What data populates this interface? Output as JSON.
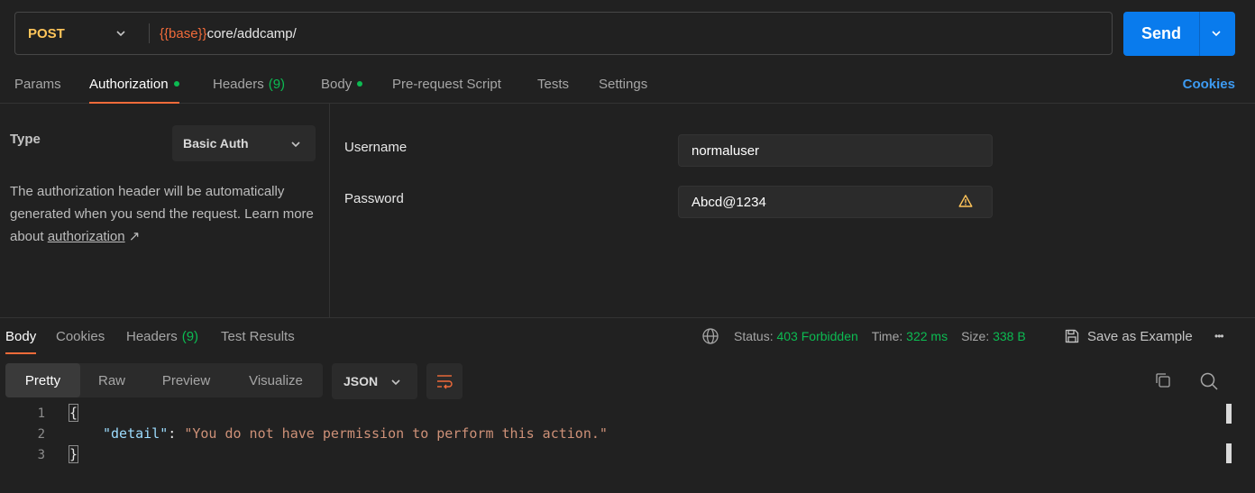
{
  "request": {
    "method": "POST",
    "url_variable": "{{base}}",
    "url_path": "core/addcamp/",
    "send_label": "Send"
  },
  "request_tabs": {
    "params": "Params",
    "authorization": "Authorization",
    "headers": "Headers",
    "headers_count": "(9)",
    "body": "Body",
    "pre_request": "Pre-request Script",
    "tests": "Tests",
    "settings": "Settings",
    "cookies": "Cookies"
  },
  "auth": {
    "type_label": "Type",
    "type_value": "Basic Auth",
    "description": "The authorization header will be automatically generated when you send the request. Learn more about ",
    "description_link": "authorization",
    "link_arrow": "↗",
    "username_label": "Username",
    "username_value": "normaluser",
    "password_label": "Password",
    "password_value": "Abcd@1234"
  },
  "response_tabs": {
    "body": "Body",
    "cookies": "Cookies",
    "headers": "Headers",
    "headers_count": "(9)",
    "test_results": "Test Results"
  },
  "response_status": {
    "status_label": "Status:",
    "status_value": "403 Forbidden",
    "time_label": "Time:",
    "time_value": "322 ms",
    "size_label": "Size:",
    "size_value": "338 B",
    "save_example": "Save as Example",
    "more": "•••"
  },
  "format": {
    "pretty": "Pretty",
    "raw": "Raw",
    "preview": "Preview",
    "visualize": "Visualize",
    "language": "JSON"
  },
  "code": {
    "line1": "1",
    "line2": "2",
    "line3": "3",
    "open_brace": "{",
    "key": "\"detail\"",
    "colon": ": ",
    "value": "\"You do not have permission to perform this action.\"",
    "close_brace": "}"
  },
  "colors": {
    "accent": "#f26b3a",
    "send": "#097bed",
    "method": "#ffc55a",
    "success": "#0cbb52",
    "link": "#3d9bf2"
  }
}
